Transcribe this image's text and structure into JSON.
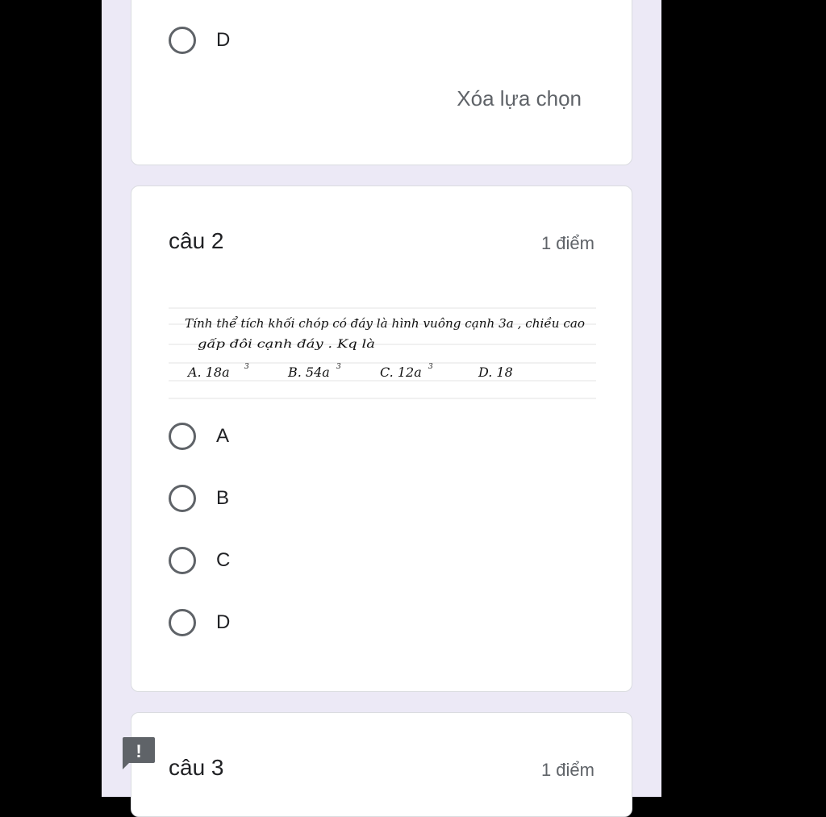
{
  "card1": {
    "option_d": "D",
    "clear_label": "Xóa lựa chọn"
  },
  "question2": {
    "title": "câu 2",
    "points": "1 điểm",
    "handwritten": {
      "line1": "Tính thể tích khối chóp có đáy là hình vuông cạnh 3a , chiều cao",
      "line2": "gấp đôi cạnh đáy . Kq là",
      "answer_a": "A. 18a",
      "answer_b": "B. 54a",
      "answer_c": "C. 12a",
      "answer_d": "D. 18",
      "exponent": "3"
    },
    "options": [
      "A",
      "B",
      "C",
      "D"
    ]
  },
  "question3": {
    "title": "câu 3",
    "points": "1 điểm"
  },
  "alert_icon": {
    "glyph": "!",
    "color": "#5f6368",
    "name": "alert-icon"
  }
}
